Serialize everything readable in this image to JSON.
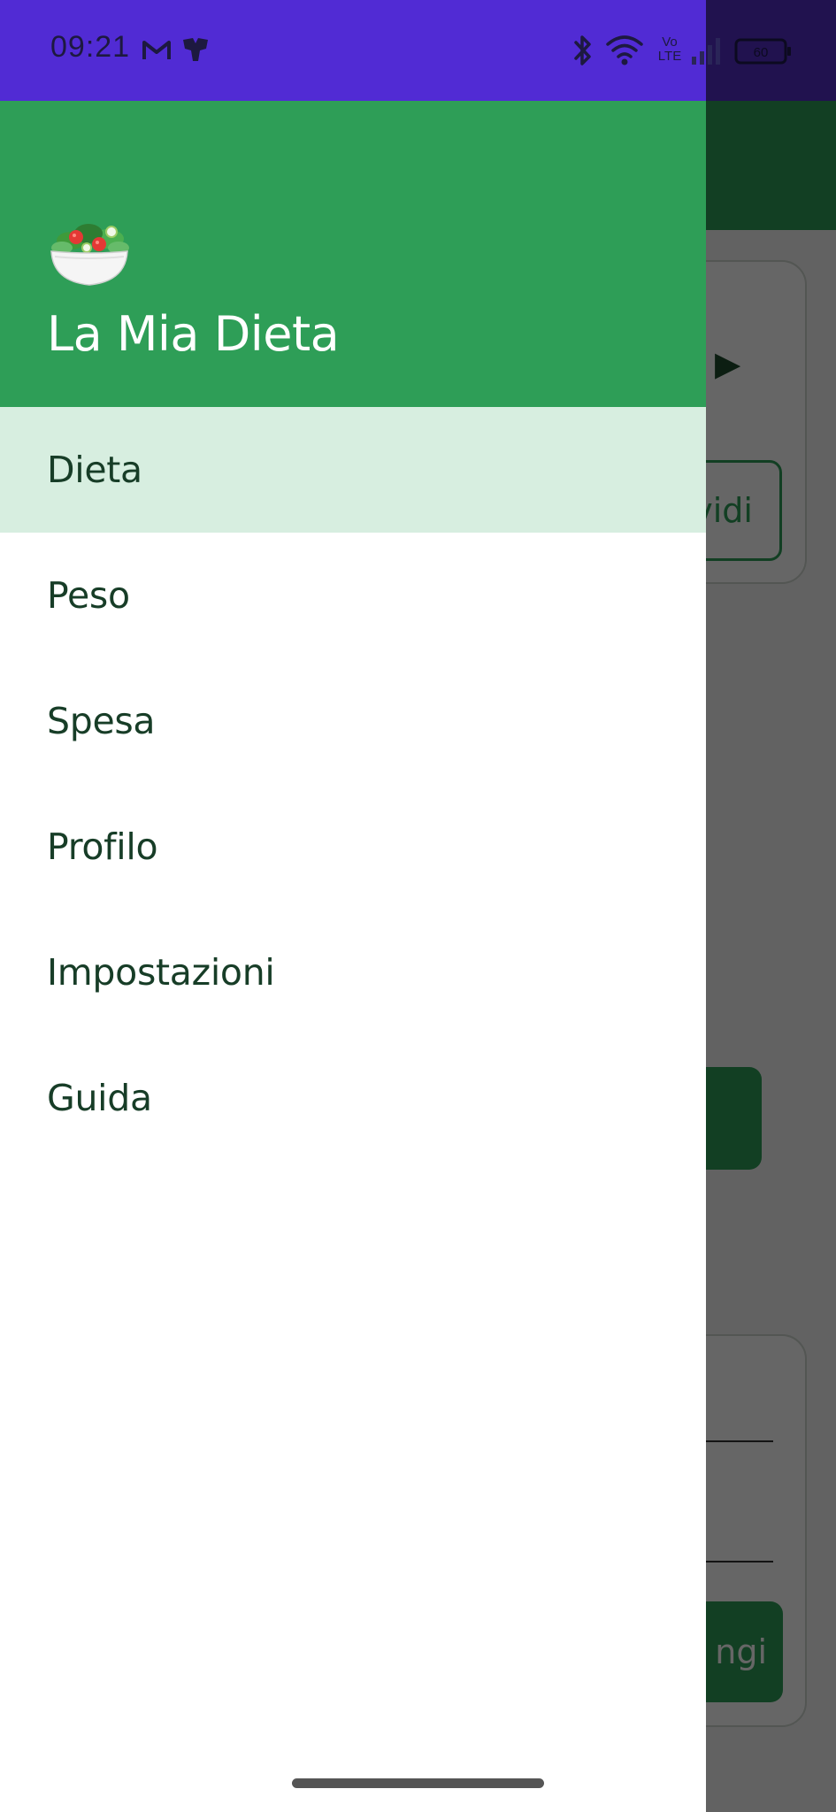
{
  "status_bar": {
    "time": "09:21",
    "network_label_top": "Vo",
    "network_label_bottom": "LTE",
    "battery_level": "60",
    "colors": {
      "bar": "#512bd4",
      "bar_dimmed": "#21124f",
      "icons": "#1d1940"
    },
    "icons": [
      "gmail-icon",
      "app-notification-icon",
      "bluetooth-icon",
      "wifi-icon",
      "volte-icon",
      "signal-icon",
      "battery-icon"
    ]
  },
  "drawer": {
    "header": {
      "emoji_icon": "salad-bowl-icon",
      "title": "La Mia Dieta",
      "color": "#2e9e57"
    },
    "items": [
      {
        "label": "Dieta",
        "active": true
      },
      {
        "label": "Peso",
        "active": false
      },
      {
        "label": "Spesa",
        "active": false
      },
      {
        "label": "Profilo",
        "active": false
      },
      {
        "label": "Impostazioni",
        "active": false
      },
      {
        "label": "Guida",
        "active": false
      }
    ],
    "active_item_color": "#d7eee0",
    "text_color": "#173d27"
  },
  "background": {
    "partial_button_1": "vidi",
    "partial_button_2": "ngi",
    "arrow_glyph": "▶"
  }
}
